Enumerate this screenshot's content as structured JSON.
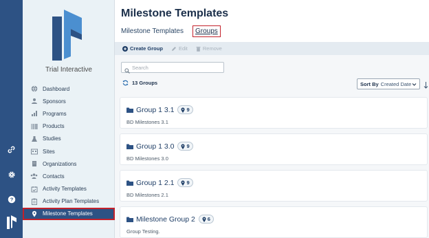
{
  "colors": {
    "rail": "#2d5284",
    "sidebar": "#eaf2f6",
    "active": "#2d5284",
    "highlight": "#c3212b",
    "title": "#1b2f4a"
  },
  "rail": {
    "icons": [
      "link-icon",
      "gear-icon",
      "help-icon",
      "logo-icon"
    ]
  },
  "sidebar": {
    "brand": "Trial Interactive",
    "items": [
      {
        "label": "Dashboard",
        "icon": "globe-icon"
      },
      {
        "label": "Sponsors",
        "icon": "sponsors-icon"
      },
      {
        "label": "Programs",
        "icon": "programs-icon"
      },
      {
        "label": "Products",
        "icon": "barcode-icon"
      },
      {
        "label": "Studies",
        "icon": "flask-icon"
      },
      {
        "label": "Sites",
        "icon": "sites-icon"
      },
      {
        "label": "Organizations",
        "icon": "building-icon"
      },
      {
        "label": "Contacts",
        "icon": "contacts-icon"
      },
      {
        "label": "Activity Templates",
        "icon": "calendar-check-icon"
      },
      {
        "label": "Activity Plan Templates",
        "icon": "clipboard-icon"
      },
      {
        "label": "Milestone Templates",
        "icon": "map-marker-icon",
        "active": true
      }
    ]
  },
  "header": {
    "title": "Milestone Templates",
    "tabs": [
      {
        "label": "Milestone Templates"
      },
      {
        "label": "Groups",
        "active": true
      }
    ]
  },
  "toolbar": {
    "create": "Create Group",
    "edit": "Edit",
    "remove": "Remove"
  },
  "search": {
    "placeholder": "Search",
    "value": ""
  },
  "summary": {
    "count_label": "13 Groups"
  },
  "sort": {
    "label": "Sort By",
    "value": "Created Date"
  },
  "groups": [
    {
      "name": "Group 1 3.1",
      "count": "9",
      "description": "BD Milestones 3.1"
    },
    {
      "name": "Group 1 3.0",
      "count": "9",
      "description": "BD Milestones 3.0"
    },
    {
      "name": "Group 1 2.1",
      "count": "9",
      "description": "BD Milestones 2.1"
    },
    {
      "name": "Milestone Group 2",
      "count": "6",
      "description": "Group Testing."
    }
  ]
}
